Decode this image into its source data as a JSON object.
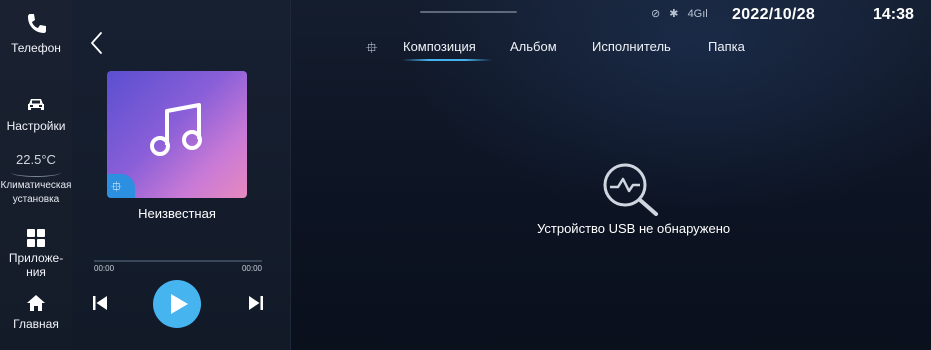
{
  "sidebar": {
    "phone_label": "Телефон",
    "settings_label": "Настройки",
    "climate_temp": "22.5°C",
    "climate_label_line1": "Климатическая",
    "climate_label_line2": "установка",
    "apps_label_line1": "Приложе-",
    "apps_label_line2": "ния",
    "home_label": "Главная",
    "icons": [
      "phone-icon",
      "car-icon",
      "apps-grid-icon",
      "home-icon"
    ]
  },
  "player": {
    "track_title": "Неизвестная",
    "time_elapsed": "00:00",
    "time_total": "00:00",
    "progress": 0,
    "icons": [
      "back-chevron-icon",
      "music-note-icon",
      "usb-icon",
      "previous-icon",
      "play-icon",
      "next-icon"
    ]
  },
  "status": {
    "network": "4G",
    "date": "2022/10/28",
    "time": "14:38",
    "icons": [
      "no-signal-icon",
      "bluetooth-icon",
      "cellular-signal-icon"
    ]
  },
  "tabs": {
    "items": [
      {
        "label": "Композиция",
        "active": true
      },
      {
        "label": "Альбом",
        "active": false
      },
      {
        "label": "Исполнитель",
        "active": false
      },
      {
        "label": "Папка",
        "active": false
      }
    ],
    "source_icon": "usb-icon"
  },
  "empty_state": {
    "message": "Устройство USB не обнаружено",
    "icon": "search-pulse-icon"
  },
  "colors": {
    "accent": "#46b4ef",
    "album_gradient_start": "#5a4fd0",
    "album_gradient_end": "#e689bf",
    "background": "#0c1322"
  }
}
